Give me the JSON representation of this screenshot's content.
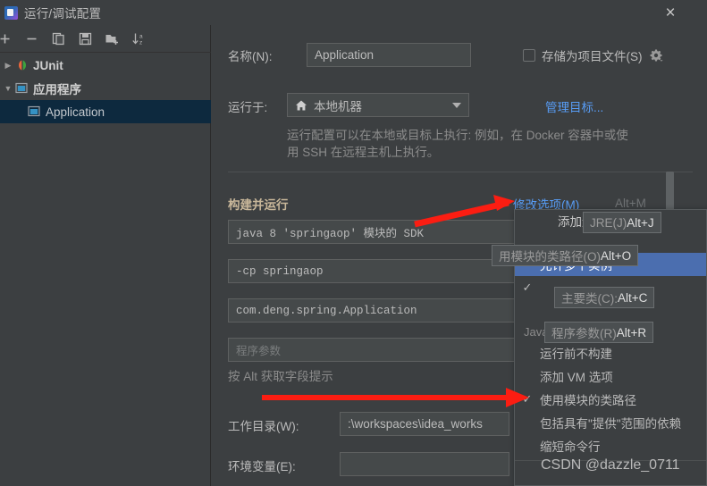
{
  "window": {
    "title": "运行/调试配置",
    "app_icon": "intellij-idea-icon",
    "close_label": "×"
  },
  "toolbar": {
    "items": [
      {
        "name": "add-button",
        "icon": "plus-icon",
        "label": "+"
      },
      {
        "name": "remove-button",
        "icon": "minus-icon",
        "label": "−"
      },
      {
        "name": "copy-button",
        "icon": "copy-icon",
        "label": "Copy"
      },
      {
        "name": "save-button",
        "icon": "save-icon",
        "label": "Save"
      },
      {
        "name": "new-folder-button",
        "icon": "folder-add-icon",
        "label": "New Folder"
      },
      {
        "name": "sort-button",
        "icon": "sort-alpha-icon",
        "label": "Sort"
      }
    ]
  },
  "tree": {
    "items": [
      {
        "label": "JUnit",
        "icon": "junit-icon",
        "twisty": "▶",
        "level": 1,
        "selected": false,
        "bold": true
      },
      {
        "label": "应用程序",
        "icon": "application-folder-icon",
        "twisty": "▼",
        "level": 1,
        "selected": false,
        "bold": true
      },
      {
        "label": "Application",
        "icon": "application-icon",
        "twisty": "",
        "level": 2,
        "selected": true,
        "bold": false
      }
    ]
  },
  "form": {
    "name_label": "名称(N):",
    "name_value": "Application",
    "store_as_project_file_label": "存储为项目文件(S)",
    "store_as_project_file_checked": false,
    "gear_icon": "gear-icon",
    "run_on_label": "运行于:",
    "run_on_value": "本地机器",
    "run_on_icon": "home-icon",
    "manage_targets_link": "管理目标...",
    "description_line1": "运行配置可以在本地或目标上执行: 例如，在 Docker 容器中或使",
    "description_line2": "用 SSH 在远程主机上执行。",
    "section_build_and_run": "构建并运行",
    "modify_options_link": "修改选项(M)",
    "modify_options_shortcut": "Alt+M",
    "jdk_value": "java 8 'springaop' 模块的 SDK",
    "vm_options_value": "-cp springaop",
    "main_class_value": "com.deng.spring.Application",
    "program_args_placeholder": "程序参数",
    "alt_hint": "按 Alt 获取字段提示",
    "working_dir_label": "工作目录(W):",
    "working_dir_value": ":\\workspaces\\idea_works",
    "env_vars_label": "环境变量(E):",
    "env_vars_value": ""
  },
  "popup": {
    "header": "添加运行选项",
    "items": [
      {
        "label": "允许多个实例",
        "checked": false,
        "selected": true
      },
      {
        "label": "",
        "checked": true,
        "selected": false
      },
      {
        "label": "",
        "checked": false,
        "selected": false
      }
    ],
    "category_java": "Java",
    "java_items": [
      {
        "label": "运行前不构建",
        "checked": false
      },
      {
        "label": "添加 VM 选项",
        "checked": false
      },
      {
        "label": "使用模块的类路径",
        "checked": true
      },
      {
        "label": "包括具有\"提供\"范围的依赖",
        "checked": false
      },
      {
        "label": "缩短命令行",
        "checked": false
      }
    ]
  },
  "tooltips": [
    {
      "name": "jre-tooltip",
      "text": "JRE(J) ",
      "accent": "Alt+J"
    },
    {
      "name": "module-classpath-tooltip",
      "text": "用模块的类路径(O) ",
      "accent": "Alt+O"
    },
    {
      "name": "main-class-tooltip",
      "text": "主要类(C): ",
      "accent": "Alt+C"
    },
    {
      "name": "program-args-tooltip",
      "text": "程序参数(R) ",
      "accent": "Alt+R"
    }
  ],
  "annotations": {
    "arrow_color": "#fb1d12",
    "arrow1_target": "修改选项(M)",
    "arrow2_target": "添加 VM 选项"
  },
  "watermark": "CSDN @dazzle_0711",
  "colors": {
    "background": "#3c3f41",
    "field": "#45494a",
    "selection_blue": "#4b6eaf",
    "tree_selection": "#0d293e",
    "link": "#589df6",
    "section_title": "#c8b79a"
  }
}
